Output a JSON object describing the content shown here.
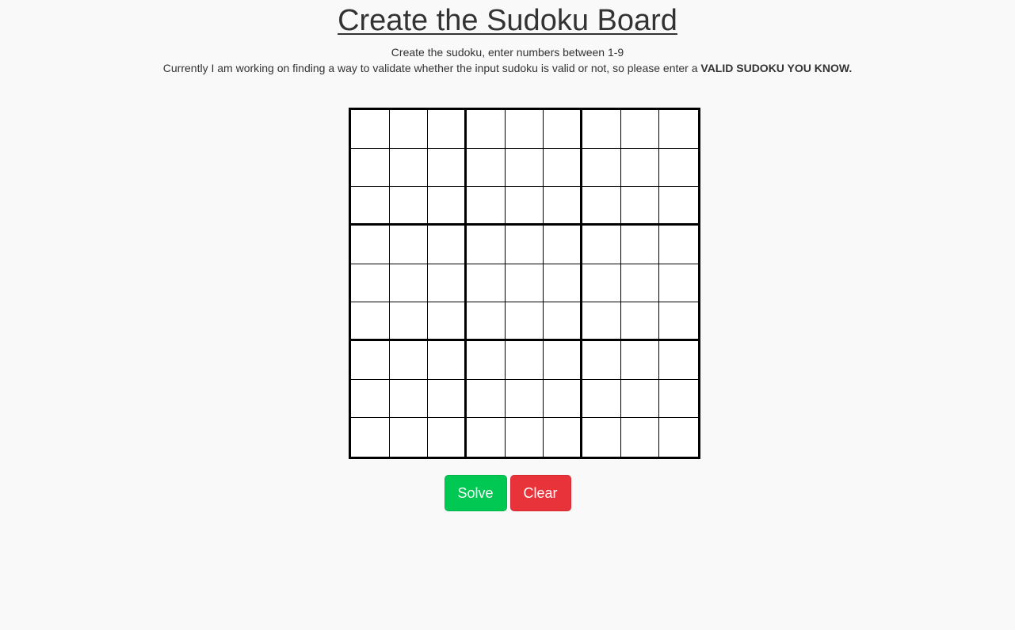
{
  "header": {
    "title": "Create the Sudoku Board",
    "subtitle_line1": "Create the sudoku, enter numbers between 1-9",
    "subtitle_line2_prefix": "Currently I am working on finding a way to validate whether the input sudoku is valid or not, so please enter a ",
    "subtitle_line2_bold": "VALID SUDOKU YOU KNOW."
  },
  "board": {
    "rows": 9,
    "cols": 9,
    "values": [
      [
        "",
        "",
        "",
        "",
        "",
        "",
        "",
        "",
        ""
      ],
      [
        "",
        "",
        "",
        "",
        "",
        "",
        "",
        "",
        ""
      ],
      [
        "",
        "",
        "",
        "",
        "",
        "",
        "",
        "",
        ""
      ],
      [
        "",
        "",
        "",
        "",
        "",
        "",
        "",
        "",
        ""
      ],
      [
        "",
        "",
        "",
        "",
        "",
        "",
        "",
        "",
        ""
      ],
      [
        "",
        "",
        "",
        "",
        "",
        "",
        "",
        "",
        ""
      ],
      [
        "",
        "",
        "",
        "",
        "",
        "",
        "",
        "",
        ""
      ],
      [
        "",
        "",
        "",
        "",
        "",
        "",
        "",
        "",
        ""
      ],
      [
        "",
        "",
        "",
        "",
        "",
        "",
        "",
        "",
        ""
      ]
    ]
  },
  "actions": {
    "solve_label": "Solve",
    "clear_label": "Clear"
  },
  "colors": {
    "background": "#f9f9f9",
    "text": "#333333",
    "solve_button": "#00c853",
    "clear_button": "#e8333a",
    "grid_line": "#000000"
  }
}
